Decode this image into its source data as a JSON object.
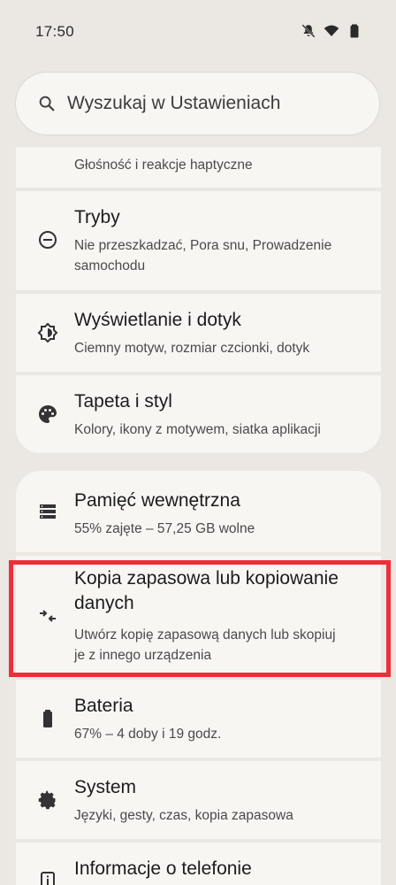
{
  "status_bar": {
    "time": "17:50",
    "icons": [
      "mute-icon",
      "wifi-icon",
      "battery-icon"
    ]
  },
  "search": {
    "placeholder": "Wyszukaj w Ustawieniach"
  },
  "settings": {
    "sound": {
      "subtitle": "Głośność i reakcje haptyczne"
    },
    "modes": {
      "title": "Tryby",
      "subtitle": "Nie przeszkadzać, Pora snu, Prowadzenie samochodu"
    },
    "display": {
      "title": "Wyświetlanie i dotyk",
      "subtitle": "Ciemny motyw, rozmiar czcionki, dotyk"
    },
    "wallpaper": {
      "title": "Tapeta i styl",
      "subtitle": "Kolory, ikony z motywem, siatka aplikacji"
    },
    "storage": {
      "title": "Pamięć wewnętrzna",
      "subtitle": "55% zajęte – 57,25 GB wolne"
    },
    "backup": {
      "title": "Kopia zapasowa lub kopiowanie danych",
      "subtitle": "Utwórz kopię zapasową danych lub skopiuj je z innego urządzenia"
    },
    "battery": {
      "title": "Bateria",
      "subtitle": "67% – 4 doby i 19 godz."
    },
    "system": {
      "title": "System",
      "subtitle": "Języki, gesty, czas, kopia zapasowa"
    },
    "about": {
      "title": "Informacje o telefonie"
    }
  },
  "colors": {
    "background": "#ebe8e3",
    "card": "#f8f6f3",
    "highlight": "#ee2e3a"
  }
}
